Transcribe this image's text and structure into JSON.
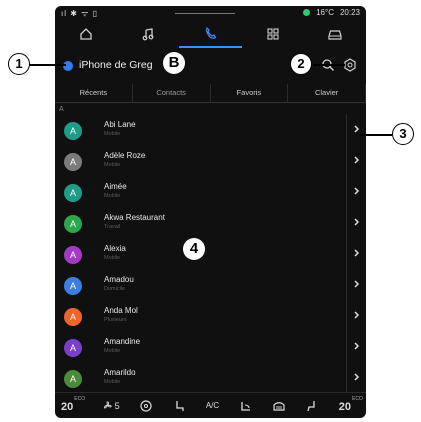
{
  "status": {
    "left_icons": "ıl ✱ ᯤ ▯",
    "temperature": "16°C",
    "time": "20:23"
  },
  "nav": [
    {
      "name": "home-icon"
    },
    {
      "name": "music-icon"
    },
    {
      "name": "phone-icon",
      "active": true
    },
    {
      "name": "apps-grid-icon"
    },
    {
      "name": "car-icon"
    }
  ],
  "header": {
    "phone_name": "iPhone de Greg"
  },
  "tabs": [
    {
      "label": "Récents"
    },
    {
      "label": "Contacts",
      "active": true
    },
    {
      "label": "Favoris"
    },
    {
      "label": "Clavier"
    }
  ],
  "section_letter": "A",
  "contacts": [
    {
      "initial": "A",
      "name": "Abi Lane",
      "type": "Mobile",
      "color": "#1e9c87"
    },
    {
      "initial": "A",
      "name": "Adèle Roze",
      "type": "Mobile",
      "color": "#7b7b7b"
    },
    {
      "initial": "A",
      "name": "Aimée",
      "type": "Mobile",
      "color": "#1e9c87"
    },
    {
      "initial": "A",
      "name": "Akwa Restaurant",
      "type": "Travail",
      "color": "#2aa84a"
    },
    {
      "initial": "A",
      "name": "Alexia",
      "type": "Mobile",
      "color": "#a53bc4"
    },
    {
      "initial": "A",
      "name": "Amadou",
      "type": "Domicile",
      "color": "#3d7fe0"
    },
    {
      "initial": "A",
      "name": "Anda Mol",
      "type": "Plusieurs",
      "color": "#f0652c"
    },
    {
      "initial": "A",
      "name": "Amandine",
      "type": "Mobile",
      "color": "#7a3fc8"
    },
    {
      "initial": "A",
      "name": "Amarildo",
      "type": "Mobile",
      "color": "#4a8a3a"
    }
  ],
  "bottom": {
    "temp_left": "20",
    "temp_sub": "ECO",
    "fan_level": "5",
    "ac_label": "A/C",
    "temp_right": "20",
    "temp_right_sub": "ECO"
  },
  "callouts": {
    "c1": "1",
    "c2": "2",
    "c3": "3",
    "cb": "B",
    "c4": "4"
  }
}
